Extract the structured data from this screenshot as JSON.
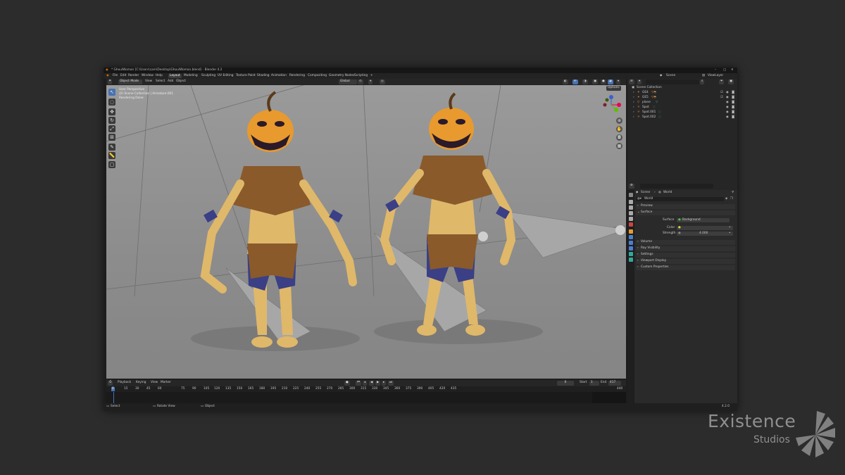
{
  "window": {
    "title": "* GhoulWoman [C:\\Users\\cam\\Desktop\\GhoulWoman.blend] - Blender 4.2"
  },
  "menu": [
    "File",
    "Edit",
    "Render",
    "Window",
    "Help"
  ],
  "workspace_tabs": [
    "Layout",
    "Modeling",
    "Sculpting",
    "UV Editing",
    "Texture Paint",
    "Shading",
    "Animation",
    "Rendering",
    "Compositing",
    "Geometry Nodes",
    "Scripting"
  ],
  "workspace_add": "+",
  "active_workspace": "Layout",
  "top_right": {
    "scene": "Scene",
    "view_layer": "ViewLayer"
  },
  "viewport": {
    "mode": "Object Mode",
    "menu": [
      "View",
      "Select",
      "Add",
      "Object"
    ],
    "transform_orientation": "Global",
    "options_label": "Options",
    "overlay_lines": [
      "User Perspective",
      "(0) Scene Collection | Armature.001",
      "Rendering Done"
    ]
  },
  "timeline": {
    "menu": [
      "Playback",
      "Keying",
      "View",
      "Marker"
    ],
    "current_frame": "0",
    "start_label": "Start",
    "start": "1",
    "end_label": "End",
    "end": "417",
    "ruler": [
      "0",
      "15",
      "30",
      "45",
      "60",
      "75",
      "90",
      "105",
      "120",
      "135",
      "150",
      "165",
      "180",
      "195",
      "210",
      "225",
      "240",
      "255",
      "270",
      "285",
      "300",
      "315",
      "330",
      "345",
      "360",
      "375",
      "390",
      "405",
      "420",
      "435"
    ],
    "ruler_last": "440"
  },
  "status_bar": {
    "select": "Select",
    "rotate": "Rotate View",
    "object": "Object",
    "version": "4.2.0"
  },
  "outliner": {
    "root": "Scene Collection",
    "items": [
      {
        "name": "GE4",
        "icon": "armature-icon",
        "color": "#e4914a"
      },
      {
        "name": "GE5",
        "icon": "armature-icon",
        "color": "#e4914a"
      },
      {
        "name": "plane",
        "icon": "mesh-icon",
        "color": "#e4914a"
      },
      {
        "name": "Spot",
        "icon": "light-icon",
        "color": "#e4914a"
      },
      {
        "name": "Spot.001",
        "icon": "light-icon",
        "color": "#e4914a"
      },
      {
        "name": "Spot.002",
        "icon": "light-icon",
        "color": "#e4914a"
      }
    ]
  },
  "properties": {
    "breadcrumb_scene": "Scene",
    "breadcrumb_world": "World",
    "world_name": "World",
    "panels": [
      "Preview",
      "Surface",
      "Volume",
      "Ray Visibility",
      "Settings",
      "Viewport Display",
      "Custom Properties"
    ],
    "surface_label": "Surface",
    "surface_value": "Background",
    "color_label": "Color",
    "strength_label": "Strength",
    "strength_value": "4.000"
  },
  "colors": {
    "accent": "#4772b3",
    "pumpkin": "#e89a2e",
    "cloth": "#8a5a2b",
    "skin": "#e0b86a",
    "pants": "#3b3f85"
  },
  "watermark": {
    "brand": "Existence",
    "sub": "Studios"
  }
}
